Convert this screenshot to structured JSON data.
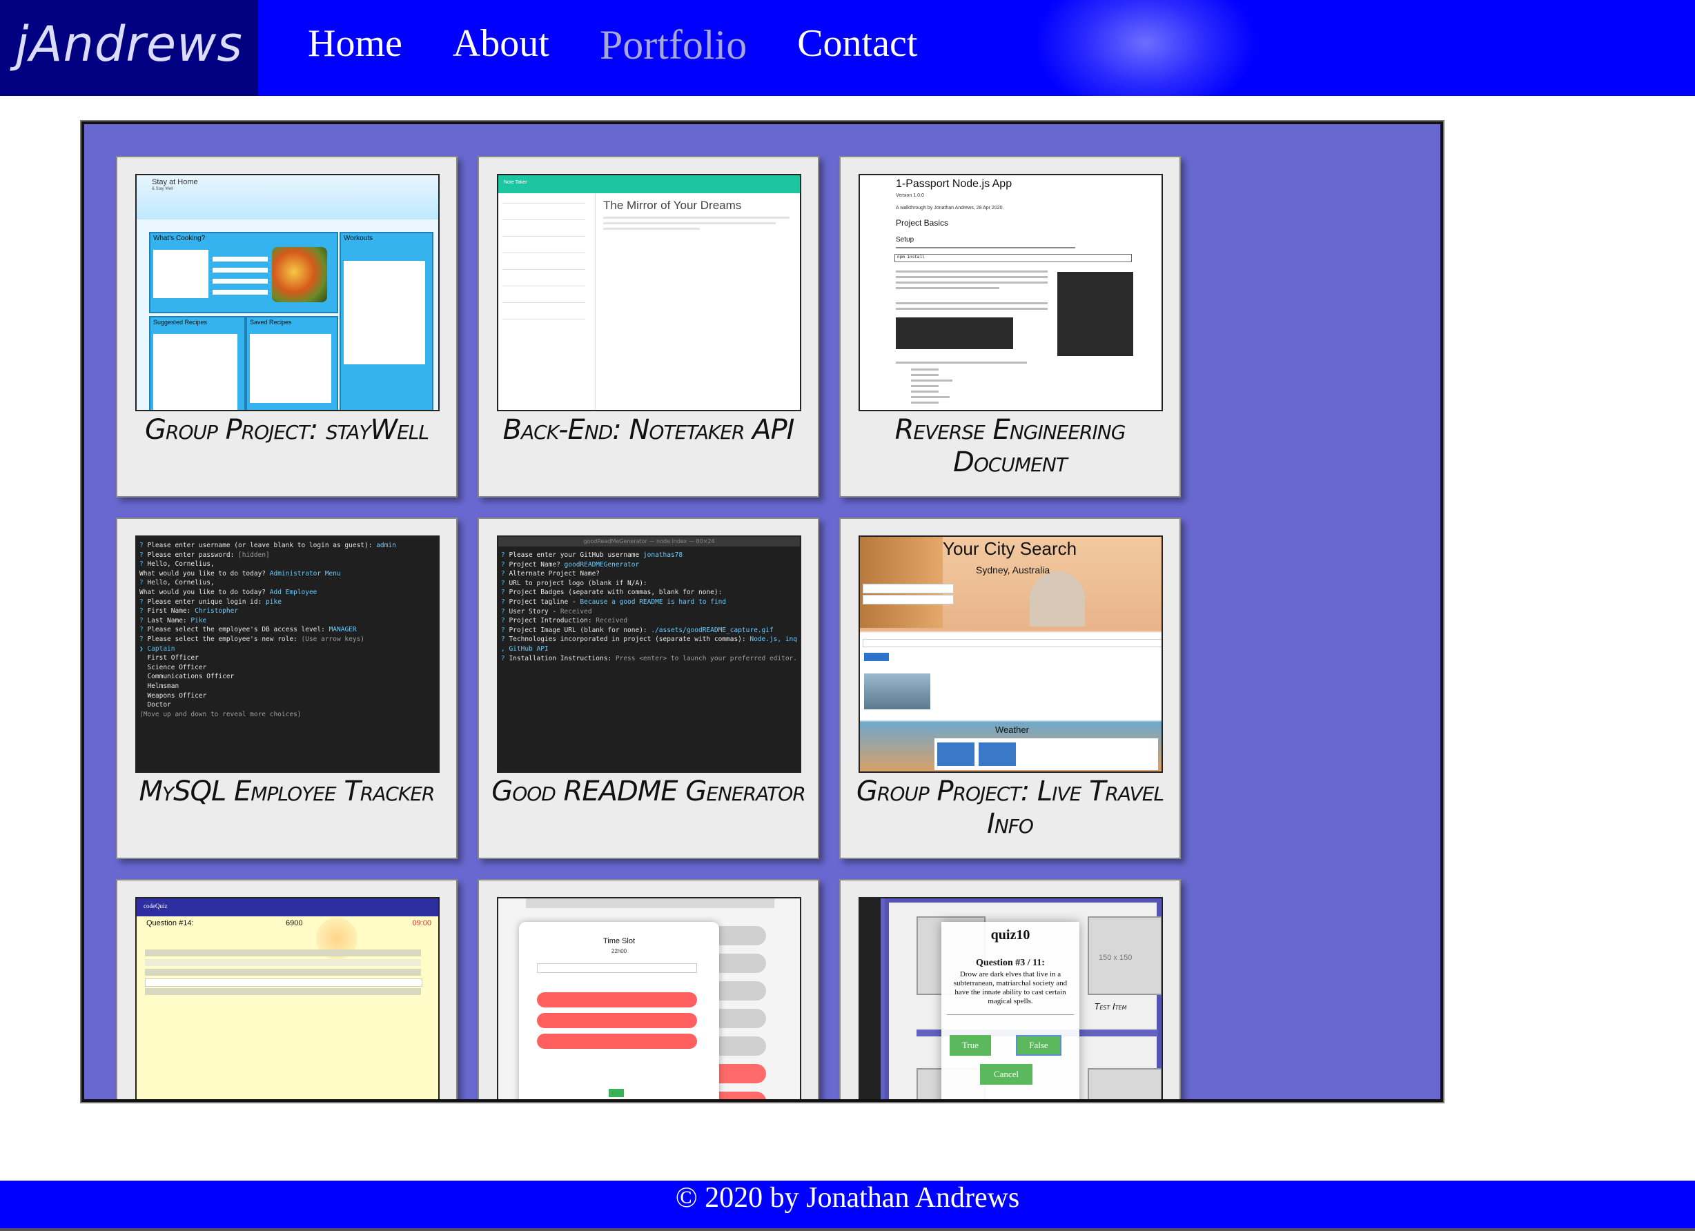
{
  "header": {
    "brand": "jAndrews",
    "nav": [
      {
        "label": "Home",
        "active": false
      },
      {
        "label": "About",
        "active": false
      },
      {
        "label": "Portfolio",
        "active": true
      },
      {
        "label": "Contact",
        "active": false
      }
    ],
    "colors": {
      "bar": "#0000ff",
      "brand_bg": "#000080",
      "active_link": "#a8a8d8"
    }
  },
  "portfolio": {
    "background": "#6868d0",
    "cards": [
      {
        "title": "Group Project: stayWell",
        "thumb": {
          "site_title": "Stay at Home",
          "site_subtitle": "& Stay Well",
          "panel_1": "What's Cooking?",
          "panel_2": "Workouts",
          "panel_3": "Suggested Recipes",
          "panel_4": "Saved Recipes"
        }
      },
      {
        "title": "Back-End: Notetaker API",
        "thumb": {
          "app_bar": "Note Taker",
          "heading": "The Mirror of Your Dreams"
        }
      },
      {
        "title": "Reverse Engineering Document",
        "thumb": {
          "heading": "1-Passport Node.js App",
          "version": "Version 1.0.0",
          "byline": "A walkthrough by Jonathan Andrews, 28 Apr 2020.",
          "section": "Project Basics",
          "subsection": "Setup",
          "command": "npm install"
        }
      },
      {
        "title": "MySQL Employee Tracker",
        "thumb": {
          "terminal": "cli"
        }
      },
      {
        "title": "Good README Generator",
        "thumb": {
          "terminal_title": "goodReadMeGenerator — node index — 80×24"
        }
      },
      {
        "title": "Group Project: Live Travel Info",
        "thumb": {
          "heading": "Your City Search",
          "subheading": "Sydney, Australia",
          "weather": "Weather"
        }
      },
      {
        "title": "",
        "thumb": {
          "brand": "codeQuiz",
          "question": "Question #14:",
          "score": "6900",
          "time": "09:00"
        }
      },
      {
        "title": "",
        "thumb": {
          "modal_title": "Time Slot",
          "time": "22h00"
        }
      },
      {
        "title": "",
        "thumb": {
          "quiz_title": "quiz10",
          "question": "Question #3 / 11:",
          "prompt": "Drow are dark elves that live in a subterranean, matriarchal society and have the innate ability to cast certain magical spells.",
          "btn_true": "True",
          "btn_false": "False",
          "btn_cancel": "Cancel",
          "placeholder": "150 x 150",
          "test_item": "Test Item"
        }
      }
    ]
  },
  "footer": {
    "text": "© 2020 by Jonathan Andrews"
  }
}
